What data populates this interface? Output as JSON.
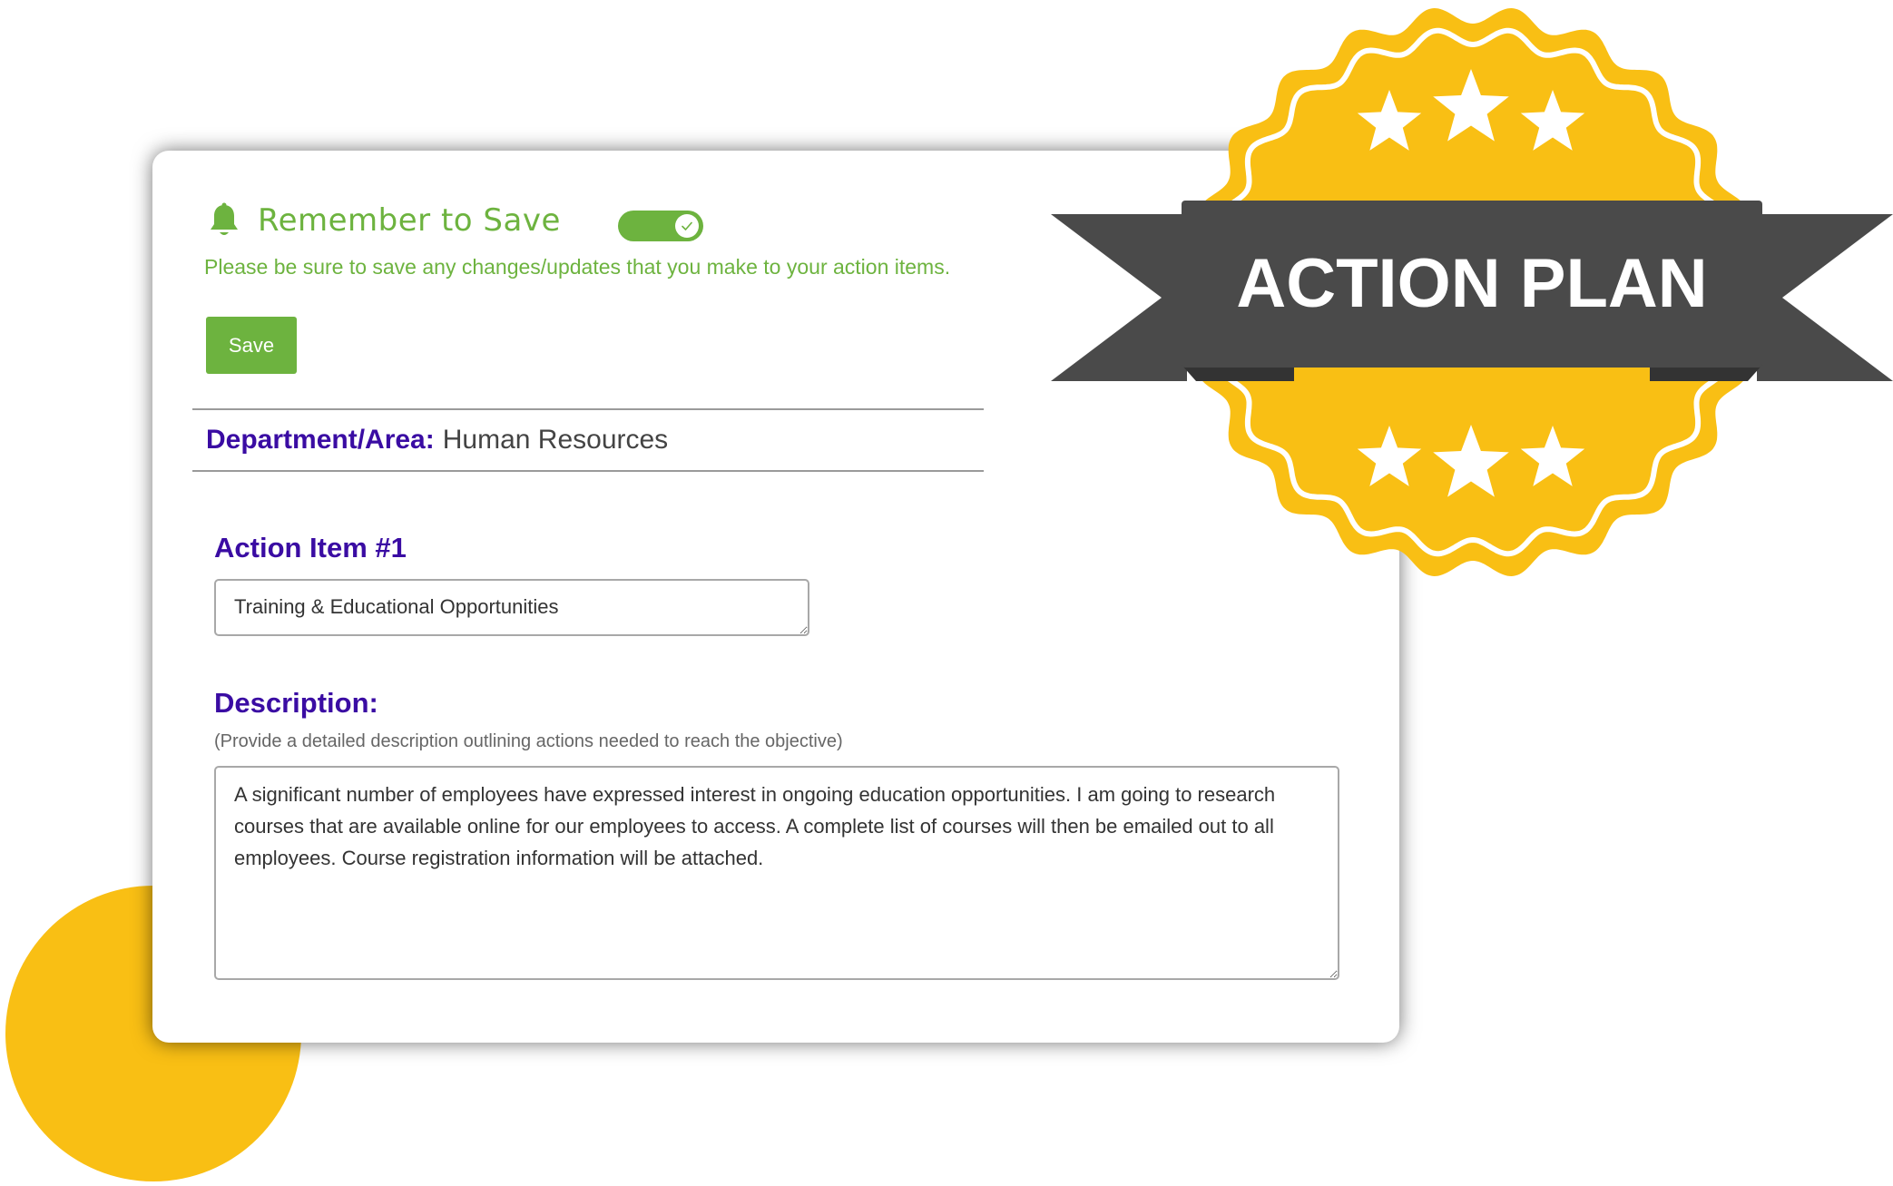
{
  "reminder": {
    "title": "Remember to Save",
    "note": "Please be sure to save any changes/updates that you make to your action items.",
    "toggle_on": true
  },
  "toolbar": {
    "save_label": "Save"
  },
  "department": {
    "label": "Department/Area:",
    "value": "Human Resources"
  },
  "action_item": {
    "title": "Action Item #1",
    "value": "Training & Educational Opportunities"
  },
  "description": {
    "title": "Description:",
    "hint": "(Provide a detailed description outlining actions needed to reach the objective)",
    "value": "A significant number of employees have expressed interest in ongoing education opportunities. I am going to research courses that are available online for our employees to access. A complete list of courses will then be emailed out to all employees. Course registration information will be attached."
  },
  "badge": {
    "text": "ACTION PLAN",
    "star_count_top": 3,
    "star_count_bottom": 3
  },
  "colors": {
    "green": "#6db33f",
    "purple": "#3a0ca3",
    "yellow": "#f9bf14",
    "ribbon": "#4a4a4a"
  },
  "icons": {
    "bell": "bell-icon",
    "check": "check-icon",
    "star": "star-icon",
    "resize": "resize-handle-icon"
  }
}
